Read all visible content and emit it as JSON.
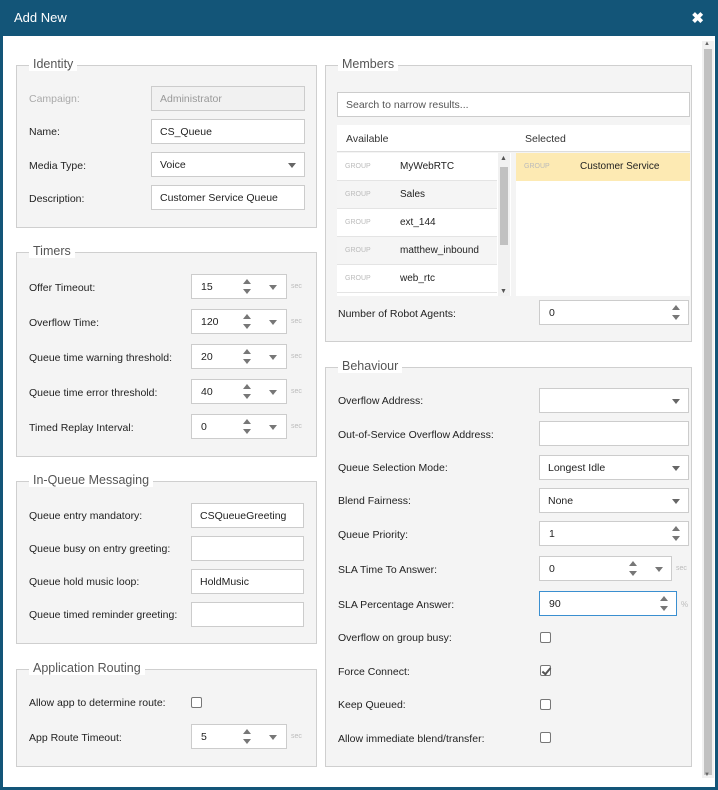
{
  "title": "Add New",
  "close_glyph": "✖",
  "identity": {
    "legend": "Identity",
    "campaign_label": "Campaign:",
    "campaign_value": "Administrator",
    "name_label": "Name:",
    "name_value": "CS_Queue",
    "media_label": "Media Type:",
    "media_value": "Voice",
    "desc_label": "Description:",
    "desc_value": "Customer Service Queue"
  },
  "timers": {
    "legend": "Timers",
    "unit": "sec",
    "items": [
      {
        "label": "Offer Timeout:",
        "value": "15"
      },
      {
        "label": "Overflow Time:",
        "value": "120"
      },
      {
        "label": "Queue time warning threshold:",
        "value": "20"
      },
      {
        "label": "Queue time error threshold:",
        "value": "40"
      },
      {
        "label": "Timed Replay Interval:",
        "value": "0"
      }
    ]
  },
  "messaging": {
    "legend": "In-Queue Messaging",
    "items": [
      {
        "label": "Queue entry mandatory:",
        "value": "CSQueueGreeting"
      },
      {
        "label": "Queue busy on entry greeting:",
        "value": ""
      },
      {
        "label": "Queue hold music loop:",
        "value": "HoldMusic"
      },
      {
        "label": "Queue timed reminder greeting:",
        "value": ""
      }
    ]
  },
  "routing": {
    "legend": "Application Routing",
    "allow_label": "Allow app to determine route:",
    "allow_checked": false,
    "timeout_label": "App Route Timeout:",
    "timeout_value": "5",
    "unit": "sec"
  },
  "members": {
    "legend": "Members",
    "search_placeholder": "Search to narrow results...",
    "available_header": "Available",
    "selected_header": "Selected",
    "group_tag": "GROUP",
    "available": [
      "MyWebRTC",
      "Sales",
      "ext_144",
      "matthew_inbound",
      "web_rtc"
    ],
    "selected": [
      "Customer Service"
    ],
    "robot_label": "Number of Robot Agents:",
    "robot_value": "0"
  },
  "behaviour": {
    "legend": "Behaviour",
    "overflow_label": "Overflow Address:",
    "overflow_value": "",
    "oos_label": "Out-of-Service Overflow Address:",
    "oos_value": "",
    "mode_label": "Queue Selection Mode:",
    "mode_value": "Longest Idle",
    "blend_label": "Blend Fairness:",
    "blend_value": "None",
    "priority_label": "Queue Priority:",
    "priority_value": "1",
    "sla_time_label": "SLA Time To Answer:",
    "sla_time_value": "0",
    "sla_time_unit": "sec",
    "sla_pct_label": "SLA Percentage Answer:",
    "sla_pct_value": "90",
    "sla_pct_unit": "%",
    "overflow_busy_label": "Overflow on group busy:",
    "overflow_busy_checked": false,
    "force_label": "Force Connect:",
    "force_checked": true,
    "keep_label": "Keep Queued:",
    "keep_checked": false,
    "immediate_label": "Allow immediate blend/transfer:",
    "immediate_checked": false
  }
}
